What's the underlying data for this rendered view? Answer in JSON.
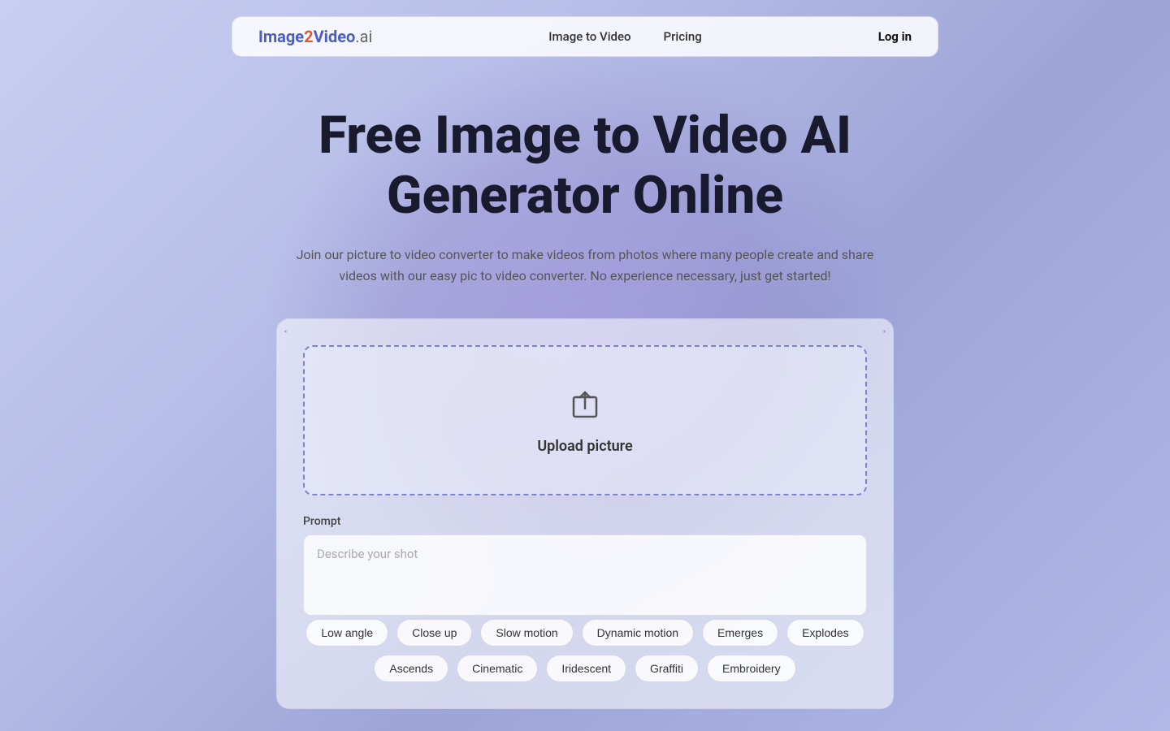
{
  "navbar": {
    "logo": {
      "image_text": "Image",
      "two_text": "2",
      "video_text": "Video",
      "ai_text": ".ai"
    },
    "links": [
      {
        "label": "Image to Video",
        "href": "#"
      },
      {
        "label": "Pricing",
        "href": "#"
      }
    ],
    "login_label": "Log in"
  },
  "hero": {
    "title": "Free Image to Video AI Generator Online",
    "subtitle": "Join our picture to video converter to make videos from photos where many people create and share videos with our easy pic to video converter. No experience necessary, just get started!"
  },
  "upload": {
    "label": "Upload picture"
  },
  "prompt": {
    "label": "Prompt",
    "placeholder": "Describe your shot"
  },
  "tags_row1": [
    {
      "label": "Low angle"
    },
    {
      "label": "Close up"
    },
    {
      "label": "Slow motion"
    },
    {
      "label": "Dynamic motion"
    },
    {
      "label": "Emerges"
    },
    {
      "label": "Explodes"
    }
  ],
  "tags_row2": [
    {
      "label": "Ascends"
    },
    {
      "label": "Cinematic"
    },
    {
      "label": "Iridescent"
    },
    {
      "label": "Graffiti"
    },
    {
      "label": "Embroidery"
    }
  ]
}
